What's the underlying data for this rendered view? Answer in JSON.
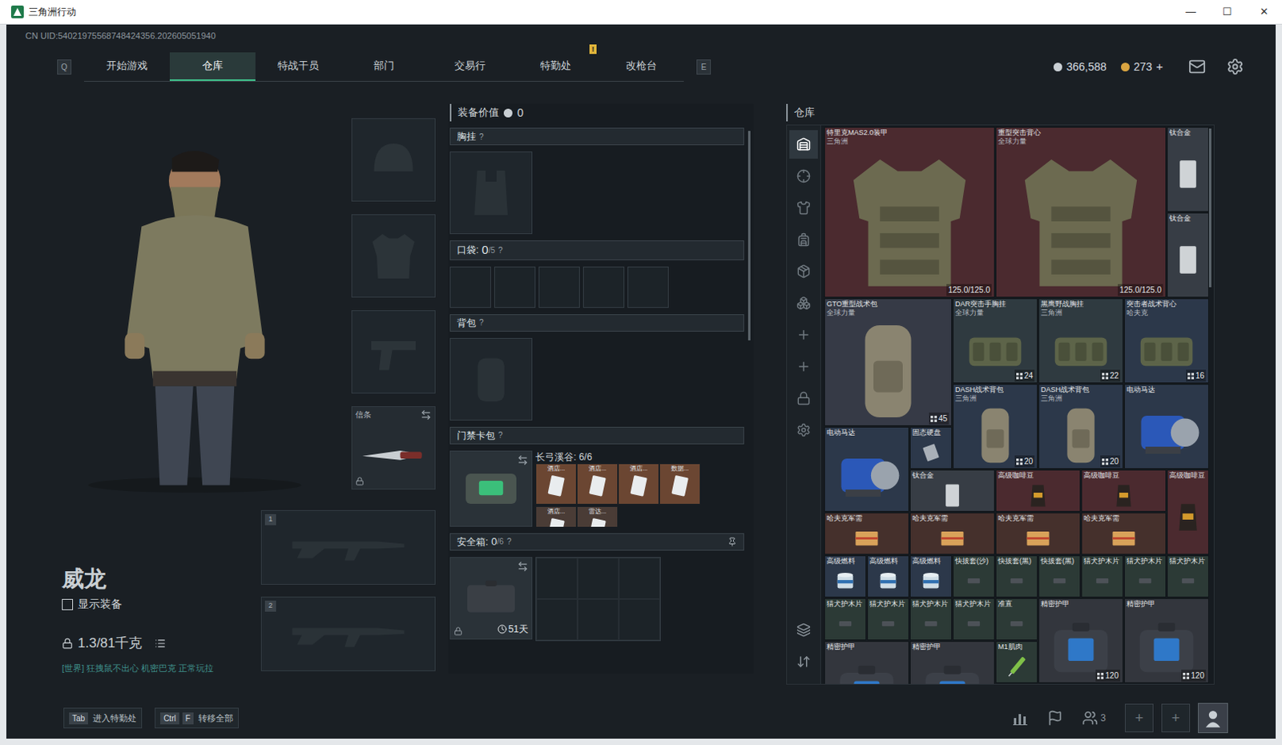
{
  "window": {
    "title": "三角洲行动",
    "controls": [
      "—",
      "☐",
      "✕"
    ]
  },
  "uid": "CN UID:54021975568748424356.202605051940",
  "nav": {
    "prev_key": "Q",
    "next_key": "E",
    "tabs": [
      {
        "label": "开始游戏",
        "selected": false,
        "badge": ""
      },
      {
        "label": "仓库",
        "selected": true,
        "badge": ""
      },
      {
        "label": "特战干员",
        "selected": false,
        "badge": ""
      },
      {
        "label": "部门",
        "selected": false,
        "badge": ""
      },
      {
        "label": "交易行",
        "selected": false,
        "badge": ""
      },
      {
        "label": "特勤处",
        "selected": false,
        "badge": "!"
      },
      {
        "label": "改枪台",
        "selected": false,
        "badge": ""
      }
    ]
  },
  "currency": [
    {
      "amount": "366,588",
      "add": "",
      "color": "#c9cfd4"
    },
    {
      "amount": "273",
      "add": "+",
      "color": "#d9a441"
    }
  ],
  "operator": {
    "name": "威龙",
    "show_gear": {
      "label": "显示装备",
      "checked": false
    },
    "weight": "1.3/81千克",
    "chat": "[世界] 狂拽鼠不出心 机密巴克 正常玩拉"
  },
  "slots": {
    "melee": {
      "label": "信条",
      "locked": true
    },
    "weapons": [
      "1",
      "2"
    ]
  },
  "loadout": {
    "value_label": "装备价值",
    "value": "0",
    "chest": {
      "label": "胸挂",
      "help": "?"
    },
    "pockets": {
      "label": "口袋:",
      "count": "0",
      "capacity": "/5",
      "help": "?",
      "slots": [
        {
          "filled": false
        },
        {
          "filled": false
        },
        {
          "filled": false
        },
        {
          "filled": false
        },
        {
          "filled": false
        }
      ]
    },
    "backpack": {
      "label": "背包",
      "help": "?"
    },
    "keycard": {
      "label": "门禁卡包",
      "help": "?",
      "map": "长弓溪谷: 6/6",
      "cards": [
        {
          "name": "酒店...",
          "color": "#6b4632"
        },
        {
          "name": "酒店...",
          "color": "#6b4632"
        },
        {
          "name": "酒店...",
          "color": "#6b4632"
        },
        {
          "name": "数据...",
          "color": "#6b4632"
        },
        {
          "name": "酒店...",
          "color": "#4a3c36"
        },
        {
          "name": "雷达...",
          "color": "#4a3c36"
        }
      ]
    },
    "safe": {
      "label": "安全箱:",
      "count": "0",
      "capacity": "/6",
      "help": "?",
      "days": "51天",
      "locked": true,
      "slots": [
        {
          "filled": false
        },
        {
          "filled": false
        },
        {
          "filled": false
        },
        {
          "filled": false
        },
        {
          "filled": false
        },
        {
          "filled": false
        }
      ]
    }
  },
  "stash": {
    "title": "仓库",
    "side_tabs": [
      {
        "selected": true
      },
      {
        "selected": false
      },
      {
        "selected": false
      },
      {
        "selected": false
      },
      {
        "selected": false
      },
      {
        "selected": false
      },
      {
        "selected": false
      },
      {
        "selected": false
      },
      {
        "selected": false
      },
      {
        "selected": false
      },
      {
        "selected": false
      },
      {
        "selected": false
      }
    ],
    "items": [
      {
        "name": "特里克MAS2.0装甲",
        "sub": "三角洲",
        "count": "",
        "durability": "125.0/125.0",
        "color": "#4b2a2f",
        "kind": "armor"
      },
      {
        "name": "重型突击背心",
        "sub": "全球力量",
        "count": "",
        "durability": "125.0/125.0",
        "color": "#4b2a2f",
        "kind": "armor"
      },
      {
        "name": "钛合金",
        "sub": "",
        "count": "",
        "durability": "",
        "color": "#373d45",
        "kind": "plate"
      },
      {
        "name": "钛合金",
        "sub": "",
        "count": "",
        "durability": "",
        "color": "#373d45",
        "kind": "plate"
      },
      {
        "name": "GTO重型战术包",
        "sub": "全球力量",
        "count": "45",
        "durability": "",
        "color": "#363a46",
        "kind": "bag"
      },
      {
        "name": "DAR突击手胸挂",
        "sub": "全球力量",
        "count": "24",
        "durability": "",
        "color": "#2f3a40",
        "kind": "rig"
      },
      {
        "name": "黑鹰野战胸挂",
        "sub": "三角洲",
        "count": "22",
        "durability": "",
        "color": "#2f3a40",
        "kind": "rig"
      },
      {
        "name": "突击者战术背心",
        "sub": "哈夫克",
        "count": "16",
        "durability": "",
        "color": "#2c384a",
        "kind": "rig"
      },
      {
        "name": "DASH战术背包",
        "sub": "三角洲",
        "count": "20",
        "durability": "",
        "color": "#2c384a",
        "kind": "bag"
      },
      {
        "name": "DASH战术背包",
        "sub": "三角洲",
        "count": "20",
        "durability": "",
        "color": "#2c384a",
        "kind": "bag"
      },
      {
        "name": "电动马达",
        "sub": "",
        "count": "",
        "durability": "",
        "color": "#2c384a",
        "kind": "motor"
      },
      {
        "name": "电动马达",
        "sub": "",
        "count": "",
        "durability": "",
        "color": "#2c384a",
        "kind": "motor"
      },
      {
        "name": "固态硬盘",
        "sub": "",
        "count": "",
        "durability": "",
        "color": "#2c384a",
        "kind": "drive"
      },
      {
        "name": "钛合金",
        "sub": "",
        "count": "",
        "durability": "",
        "color": "#373d45",
        "kind": "plate"
      },
      {
        "name": "高级咖啡豆",
        "sub": "",
        "count": "",
        "durability": "",
        "color": "#4b2a2f",
        "kind": "coffee"
      },
      {
        "name": "高级咖啡豆",
        "sub": "",
        "count": "",
        "durability": "",
        "color": "#4b2a2f",
        "kind": "coffee"
      },
      {
        "name": "高级咖啡豆",
        "sub": "",
        "count": "",
        "durability": "",
        "color": "#4b2a2f",
        "kind": "coffee"
      },
      {
        "name": "哈夫克军需",
        "sub": "",
        "count": "",
        "durability": "",
        "color": "#45302c",
        "kind": "box"
      },
      {
        "name": "哈夫克军需",
        "sub": "",
        "count": "",
        "durability": "",
        "color": "#45302c",
        "kind": "box"
      },
      {
        "name": "哈夫克军需",
        "sub": "",
        "count": "",
        "durability": "",
        "color": "#45302c",
        "kind": "box"
      },
      {
        "name": "哈夫克军需",
        "sub": "",
        "count": "",
        "durability": "",
        "color": "#45302c",
        "kind": "box"
      },
      {
        "name": "高级燃料",
        "sub": "",
        "count": "",
        "durability": "",
        "color": "#2c384a",
        "kind": "can"
      },
      {
        "name": "高级燃料",
        "sub": "",
        "count": "",
        "durability": "",
        "color": "#2c384a",
        "kind": "can"
      },
      {
        "name": "高级燃料",
        "sub": "",
        "count": "",
        "durability": "",
        "color": "#2c384a",
        "kind": "can"
      },
      {
        "name": "快拔套(沙)",
        "sub": "",
        "count": "",
        "durability": "",
        "color": "#2c3a36",
        "kind": "small"
      },
      {
        "name": "快拔套(黑)",
        "sub": "",
        "count": "",
        "durability": "",
        "color": "#2c3a36",
        "kind": "small"
      },
      {
        "name": "快拔套(黑)",
        "sub": "",
        "count": "",
        "durability": "",
        "color": "#2c3a36",
        "kind": "small"
      },
      {
        "name": "猎犬护木片",
        "sub": "",
        "count": "",
        "durability": "",
        "color": "#2c3a36",
        "kind": "small"
      },
      {
        "name": "猎犬护木片",
        "sub": "",
        "count": "",
        "durability": "",
        "color": "#2c3a36",
        "kind": "small"
      },
      {
        "name": "猎犬护木片",
        "sub": "",
        "count": "",
        "durability": "",
        "color": "#2c3a36",
        "kind": "small"
      },
      {
        "name": "猎犬护木片",
        "sub": "",
        "count": "",
        "durability": "",
        "color": "#2c3a36",
        "kind": "small"
      },
      {
        "name": "猎犬护木片",
        "sub": "",
        "count": "",
        "durability": "",
        "color": "#2c3a36",
        "kind": "small"
      },
      {
        "name": "猎犬护木片",
        "sub": "",
        "count": "",
        "durability": "",
        "color": "#2c3a36",
        "kind": "small"
      },
      {
        "name": "猎犬护木片",
        "sub": "",
        "count": "",
        "durability": "",
        "color": "#2c3a36",
        "kind": "small"
      },
      {
        "name": "准直",
        "sub": "",
        "count": "",
        "durability": "",
        "color": "#2c3a36",
        "kind": "small"
      },
      {
        "name": "精密护甲",
        "sub": "",
        "count": "120",
        "durability": "",
        "color": "#33363d",
        "kind": "case"
      },
      {
        "name": "精密护甲",
        "sub": "",
        "count": "120",
        "durability": "",
        "color": "#33363d",
        "kind": "case"
      },
      {
        "name": "精密护甲",
        "sub": "",
        "count": "",
        "durability": "",
        "color": "#33363d",
        "kind": "case"
      },
      {
        "name": "精密护甲",
        "sub": "",
        "count": "",
        "durability": "",
        "color": "#33363d",
        "kind": "case"
      },
      {
        "name": "M1肌肉",
        "sub": "",
        "count": "",
        "durability": "",
        "color": "#2c3a36",
        "kind": "stim"
      }
    ]
  },
  "footer": {
    "hints": [
      {
        "keys": [
          "Tab"
        ],
        "label": "进入特勤处"
      },
      {
        "keys": [
          "Ctrl",
          "F"
        ],
        "label": "转移全部"
      }
    ],
    "squad": "3",
    "plus": [
      "+",
      "+"
    ]
  }
}
